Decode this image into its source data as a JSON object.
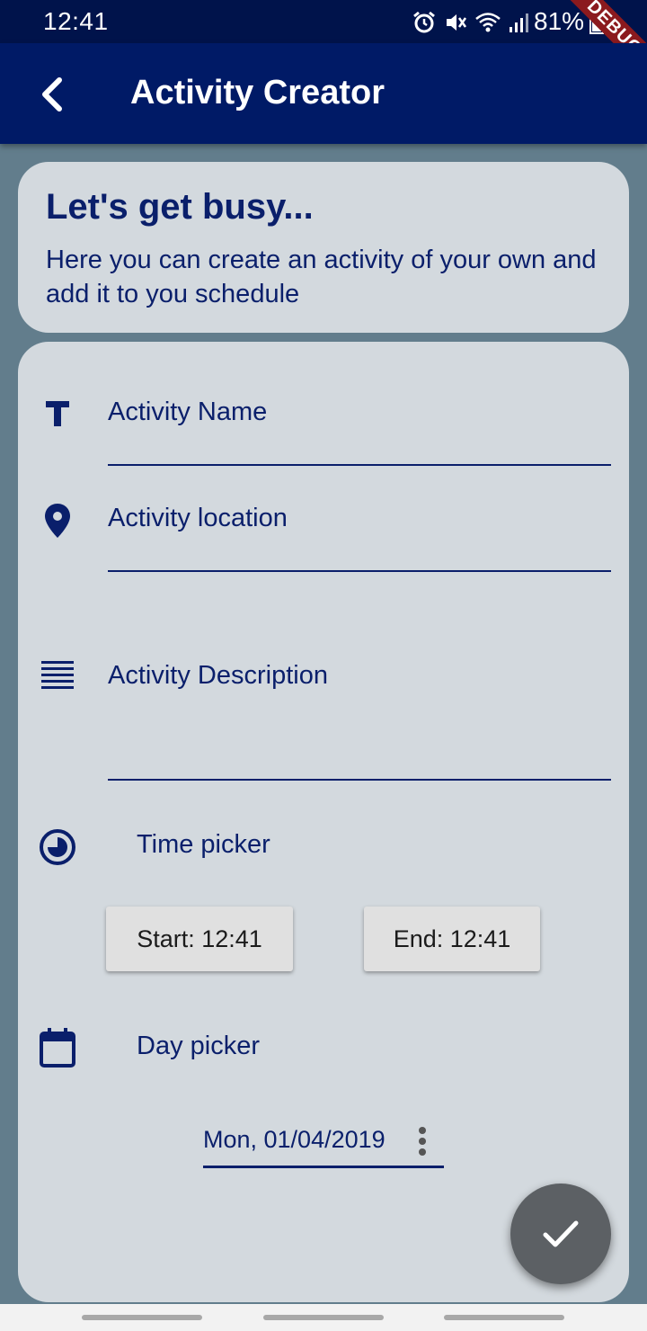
{
  "status_bar": {
    "time": "12:41",
    "battery": "81%",
    "icons": [
      "alarm-icon",
      "mute-icon",
      "wifi-icon",
      "signal-icon",
      "battery-icon"
    ]
  },
  "debug_banner": "DEBUG",
  "app_bar": {
    "title": "Activity Creator",
    "back_icon": "chevron-left-icon"
  },
  "intro": {
    "title": "Let's get busy...",
    "text": "Here you can create an activity of your own and add it to you schedule"
  },
  "form": {
    "name_placeholder": "Activity Name",
    "location_placeholder": "Activity location",
    "description_placeholder": "Activity Description",
    "time_label": "Time picker",
    "start_button": "Start: 12:41",
    "end_button": "End: 12:41",
    "day_label": "Day picker",
    "date_value": "Mon, 01/04/2019"
  },
  "fab": {
    "icon": "check-icon"
  },
  "colors": {
    "app_bar": "#001a66",
    "status_bar": "#00134b",
    "background": "#627d8c",
    "card": "#d3d9de",
    "accent": "#0a1f6b",
    "fab": "#5c6064"
  }
}
